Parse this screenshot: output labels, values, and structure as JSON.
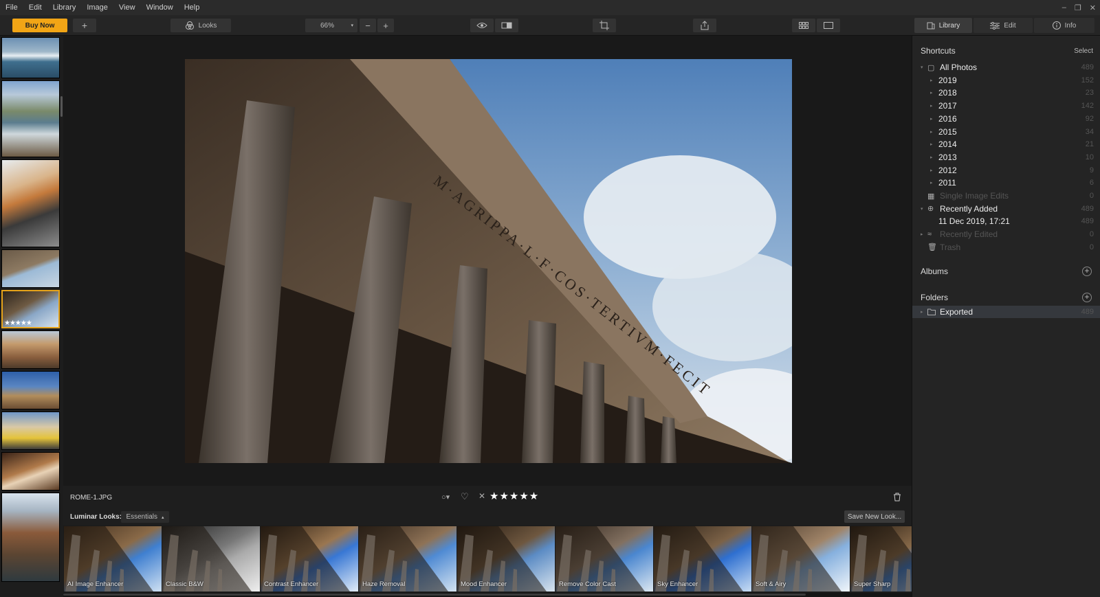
{
  "menu": [
    "File",
    "Edit",
    "Library",
    "Image",
    "View",
    "Window",
    "Help"
  ],
  "window_controls": [
    "–",
    "❐",
    "✕"
  ],
  "toolbar": {
    "buy_now": "Buy Now",
    "add": "+",
    "looks": "Looks",
    "zoom": "66%",
    "zoom_out": "−",
    "zoom_in": "+"
  },
  "tabs": [
    {
      "label": "Library",
      "icon": "library-icon"
    },
    {
      "label": "Edit",
      "icon": "sliders-icon"
    },
    {
      "label": "Info",
      "icon": "info-icon"
    }
  ],
  "file_name": "ROME-1.JPG",
  "rating": {
    "stars": "★★★★★",
    "thumb_stars": "★★★★★"
  },
  "looks_bar": {
    "label": "Luminar Looks:",
    "category": "Essentials",
    "save": "Save New Look..."
  },
  "looks": [
    "AI Image Enhancer",
    "Classic B&W",
    "Contrast Enhancer",
    "Haze Removal",
    "Mood Enhancer",
    "Remove Color Cast",
    "Sky Enhancer",
    "Soft & Airy",
    "Super Sharp"
  ],
  "sidebar": {
    "shortcuts_title": "Shortcuts",
    "select": "Select",
    "items": [
      {
        "label": "All Photos",
        "count": "489",
        "level": 0,
        "arrow": "▾",
        "icon": "▢",
        "dim": false
      },
      {
        "label": "2019",
        "count": "152",
        "level": 1,
        "arrow": "▸",
        "dim": false
      },
      {
        "label": "2018",
        "count": "23",
        "level": 1,
        "arrow": "▸",
        "dim": false
      },
      {
        "label": "2017",
        "count": "142",
        "level": 1,
        "arrow": "▸",
        "dim": false
      },
      {
        "label": "2016",
        "count": "92",
        "level": 1,
        "arrow": "▸",
        "dim": false
      },
      {
        "label": "2015",
        "count": "34",
        "level": 1,
        "arrow": "▸",
        "dim": false
      },
      {
        "label": "2014",
        "count": "21",
        "level": 1,
        "arrow": "▸",
        "dim": false
      },
      {
        "label": "2013",
        "count": "10",
        "level": 1,
        "arrow": "▸",
        "dim": false
      },
      {
        "label": "2012",
        "count": "9",
        "level": 1,
        "arrow": "▸",
        "dim": false
      },
      {
        "label": "2011",
        "count": "6",
        "level": 1,
        "arrow": "▸",
        "dim": false
      },
      {
        "label": "Single Image Edits",
        "count": "0",
        "level": 0,
        "arrow": "",
        "icon": "▦",
        "dim": true
      },
      {
        "label": "Recently Added",
        "count": "489",
        "level": 0,
        "arrow": "▾",
        "icon": "⊕",
        "dim": false
      },
      {
        "label": "11 Dec 2019, 17:21",
        "count": "489",
        "level": 1,
        "arrow": "",
        "dim": false
      },
      {
        "label": "Recently Edited",
        "count": "0",
        "level": 0,
        "arrow": "▸",
        "icon": "≈",
        "dim": true
      },
      {
        "label": "Trash",
        "count": "0",
        "level": 0,
        "arrow": "",
        "icon": "🗑",
        "dim": true
      }
    ],
    "albums_title": "Albums",
    "folders_title": "Folders",
    "folders": [
      {
        "label": "Exported",
        "count": "489"
      }
    ]
  }
}
